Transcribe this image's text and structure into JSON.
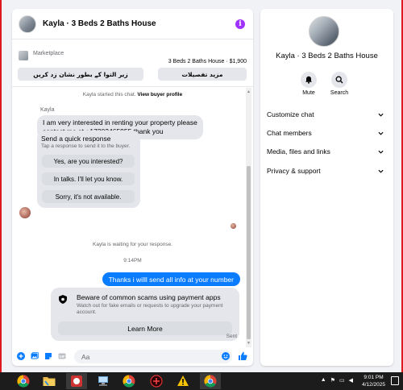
{
  "chat": {
    "title": "Kayla · 3 Beds 2 Baths House",
    "marketplace_label": "Marketplace",
    "listing_price": "3 Beds 2 Baths House · $1,900",
    "btn_mark_pending": "زیر التوا کے بطور نشان زد کریں",
    "btn_more_details": "مزید تفصیلات",
    "started_note": "Kayla started this chat.",
    "view_profile": "View buyer profile",
    "sender_name": "Kayla",
    "message_1_line1": "I am very interested in renting your property please",
    "message_1_line2": "contact me at +17203465955 thank you",
    "quick_title": "Send a quick response",
    "quick_sub": "Tap a response to send it to the buyer.",
    "quick_1": "Yes, are you interested?",
    "quick_2": "In talks. I'll let you know.",
    "quick_3": "Sorry, it's not available.",
    "waiting_note": "Kayla is waiting for your response.",
    "time_stamp": "9:14PM",
    "outgoing_message": "Thanks i willl send all info at your number",
    "scam_title": "Beware of common scams using payment apps",
    "scam_desc": "Watch out for fake emails or requests to upgrade your payment account.",
    "learn_more": "Learn More",
    "sent_status": "Sent",
    "composer_placeholder": "Aa"
  },
  "info": {
    "title": "Kayla · 3 Beds 2 Baths House",
    "mute_label": "Mute",
    "search_label": "Search",
    "rows": [
      "Customize chat",
      "Chat members",
      "Media, files and links",
      "Privacy & support"
    ]
  },
  "taskbar": {
    "time": "9:01 PM",
    "date": "4/12/2025",
    "apps": [
      "chrome-icon",
      "folder-icon",
      "app-red-icon",
      "network-icon",
      "chrome-icon",
      "game-icon",
      "warning-icon",
      "chrome-active-icon"
    ]
  },
  "colors": {
    "accent": "#0a7cff",
    "info_purple": "#a033ff",
    "bubble_bg": "#e4e6eb"
  }
}
